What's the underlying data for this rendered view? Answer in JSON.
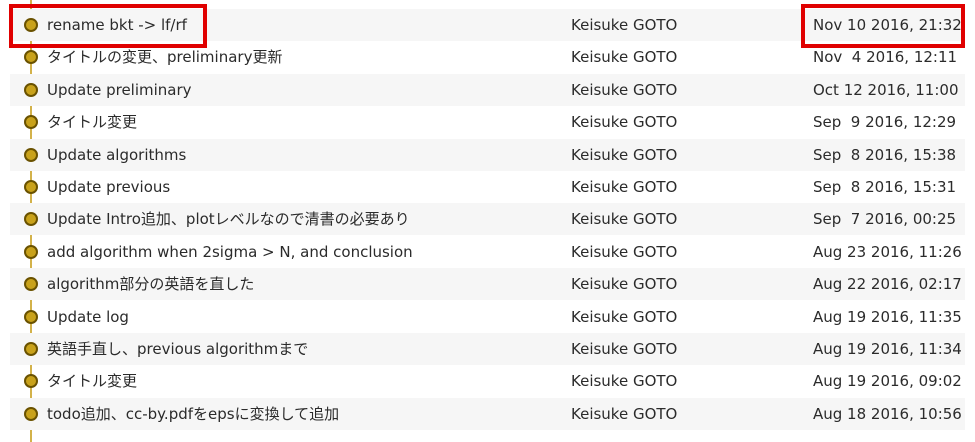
{
  "colors": {
    "graph_line": "#d3b24a",
    "node_fill": "#c9a21b",
    "node_border": "#6a5200",
    "row_alt_bg": "#f6f6f6",
    "highlight": "#e00000"
  },
  "commits": [
    {
      "message": "rename bkt -> lf/rf",
      "author": "Keisuke GOTO",
      "date": "Nov 10 2016, 21:32"
    },
    {
      "message": "タイトルの変更、preliminary更新",
      "author": "Keisuke GOTO",
      "date": "Nov  4 2016, 12:11"
    },
    {
      "message": "Update preliminary",
      "author": "Keisuke GOTO",
      "date": "Oct 12 2016, 11:00"
    },
    {
      "message": "タイトル変更",
      "author": "Keisuke GOTO",
      "date": "Sep  9 2016, 12:29"
    },
    {
      "message": "Update algorithms",
      "author": "Keisuke GOTO",
      "date": "Sep  8 2016, 15:38"
    },
    {
      "message": "Update previous",
      "author": "Keisuke GOTO",
      "date": "Sep  8 2016, 15:31"
    },
    {
      "message": "Update Intro追加、plotレベルなので清書の必要あり",
      "author": "Keisuke GOTO",
      "date": "Sep  7 2016, 00:25"
    },
    {
      "message": "add algorithm when 2sigma > N, and conclusion",
      "author": "Keisuke GOTO",
      "date": "Aug 23 2016, 11:26"
    },
    {
      "message": "algorithm部分の英語を直した",
      "author": "Keisuke GOTO",
      "date": "Aug 22 2016, 02:17"
    },
    {
      "message": "Update log",
      "author": "Keisuke GOTO",
      "date": "Aug 19 2016, 11:35"
    },
    {
      "message": "英語手直し、previous algorithmまで",
      "author": "Keisuke GOTO",
      "date": "Aug 19 2016, 11:34"
    },
    {
      "message": "タイトル変更",
      "author": "Keisuke GOTO",
      "date": "Aug 19 2016, 09:02"
    },
    {
      "message": "todo追加、cc-by.pdfをepsに変換して追加",
      "author": "Keisuke GOTO",
      "date": "Aug 18 2016, 10:56"
    }
  ]
}
